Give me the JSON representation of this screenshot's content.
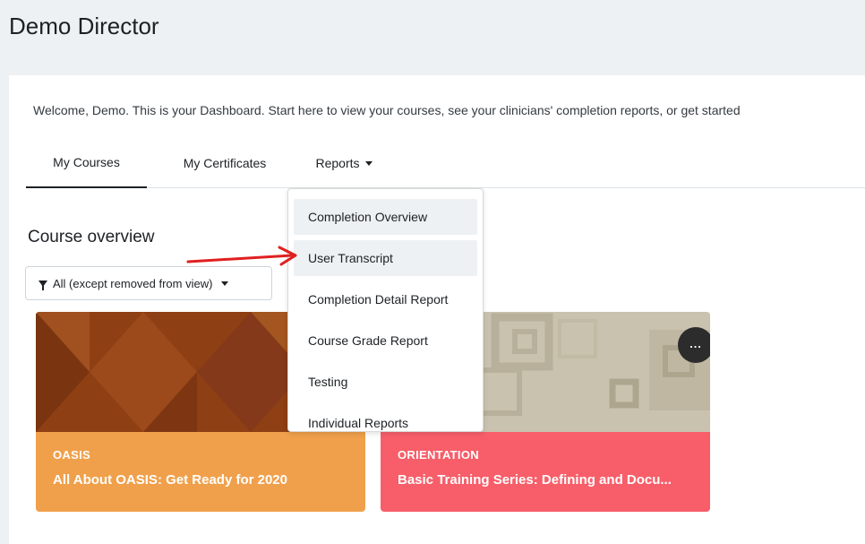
{
  "header": {
    "title": "Demo Director"
  },
  "welcome_text": "Welcome, Demo. This is your Dashboard. Start here to view your courses, see your clinicians' completion reports, or get started",
  "tabs": [
    {
      "label": "My Courses",
      "active": true
    },
    {
      "label": "My Certificates",
      "active": false
    },
    {
      "label": "Reports",
      "active": false
    }
  ],
  "section_title": "Course overview",
  "filter": {
    "label": "All (except removed from view)",
    "icon": "filter-icon"
  },
  "reports_menu": {
    "items": [
      "Completion Overview",
      "User Transcript",
      "Completion Detail Report",
      "Course Grade Report",
      "Testing",
      "Individual Reports"
    ]
  },
  "courses": [
    {
      "category": "OASIS",
      "name": "All About OASIS: Get Ready for 2020",
      "color": "#f0a04b"
    },
    {
      "category": "Orientation",
      "name": "Basic Training Series: Defining and Docu...",
      "color": "#f75e69",
      "menu_label": "..."
    }
  ],
  "colors": {
    "background": "#eef1f3",
    "card_orange": "#f0a04b",
    "card_red": "#f75e69",
    "annotation_arrow": "#e02020"
  }
}
